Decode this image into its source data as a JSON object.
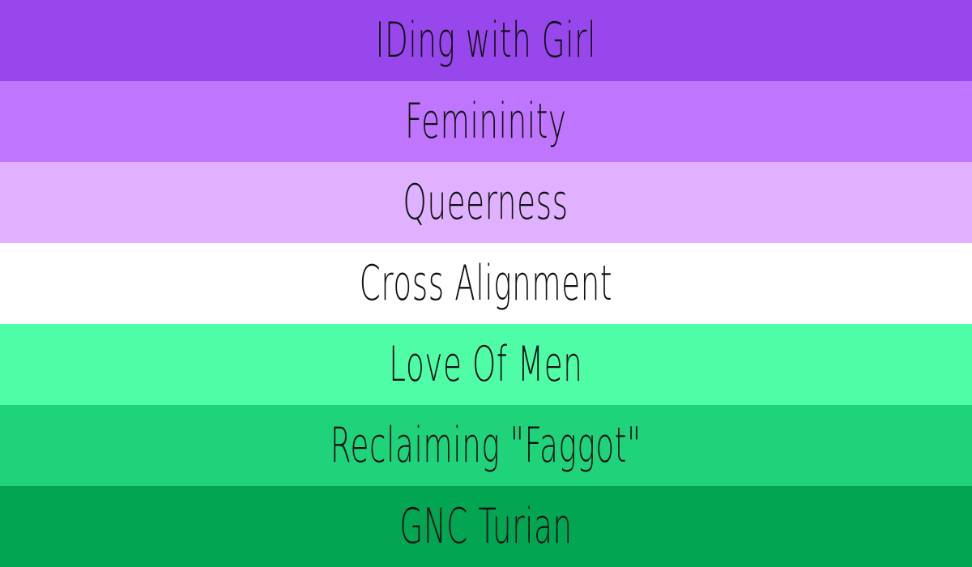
{
  "flag": {
    "stripes": [
      {
        "label": "IDing with Girl",
        "color": "#9747ec"
      },
      {
        "label": "Femininity",
        "color": "#bf75fe"
      },
      {
        "label": "Queerness",
        "color": "#dfb1ff"
      },
      {
        "label": "Cross Alignment",
        "color": "#ffffff"
      },
      {
        "label": "Love Of Men",
        "color": "#4efda6"
      },
      {
        "label": "Reclaiming \"Faggot\"",
        "color": "#1fd37a"
      },
      {
        "label": "GNC Turian",
        "color": "#02a552"
      }
    ]
  }
}
